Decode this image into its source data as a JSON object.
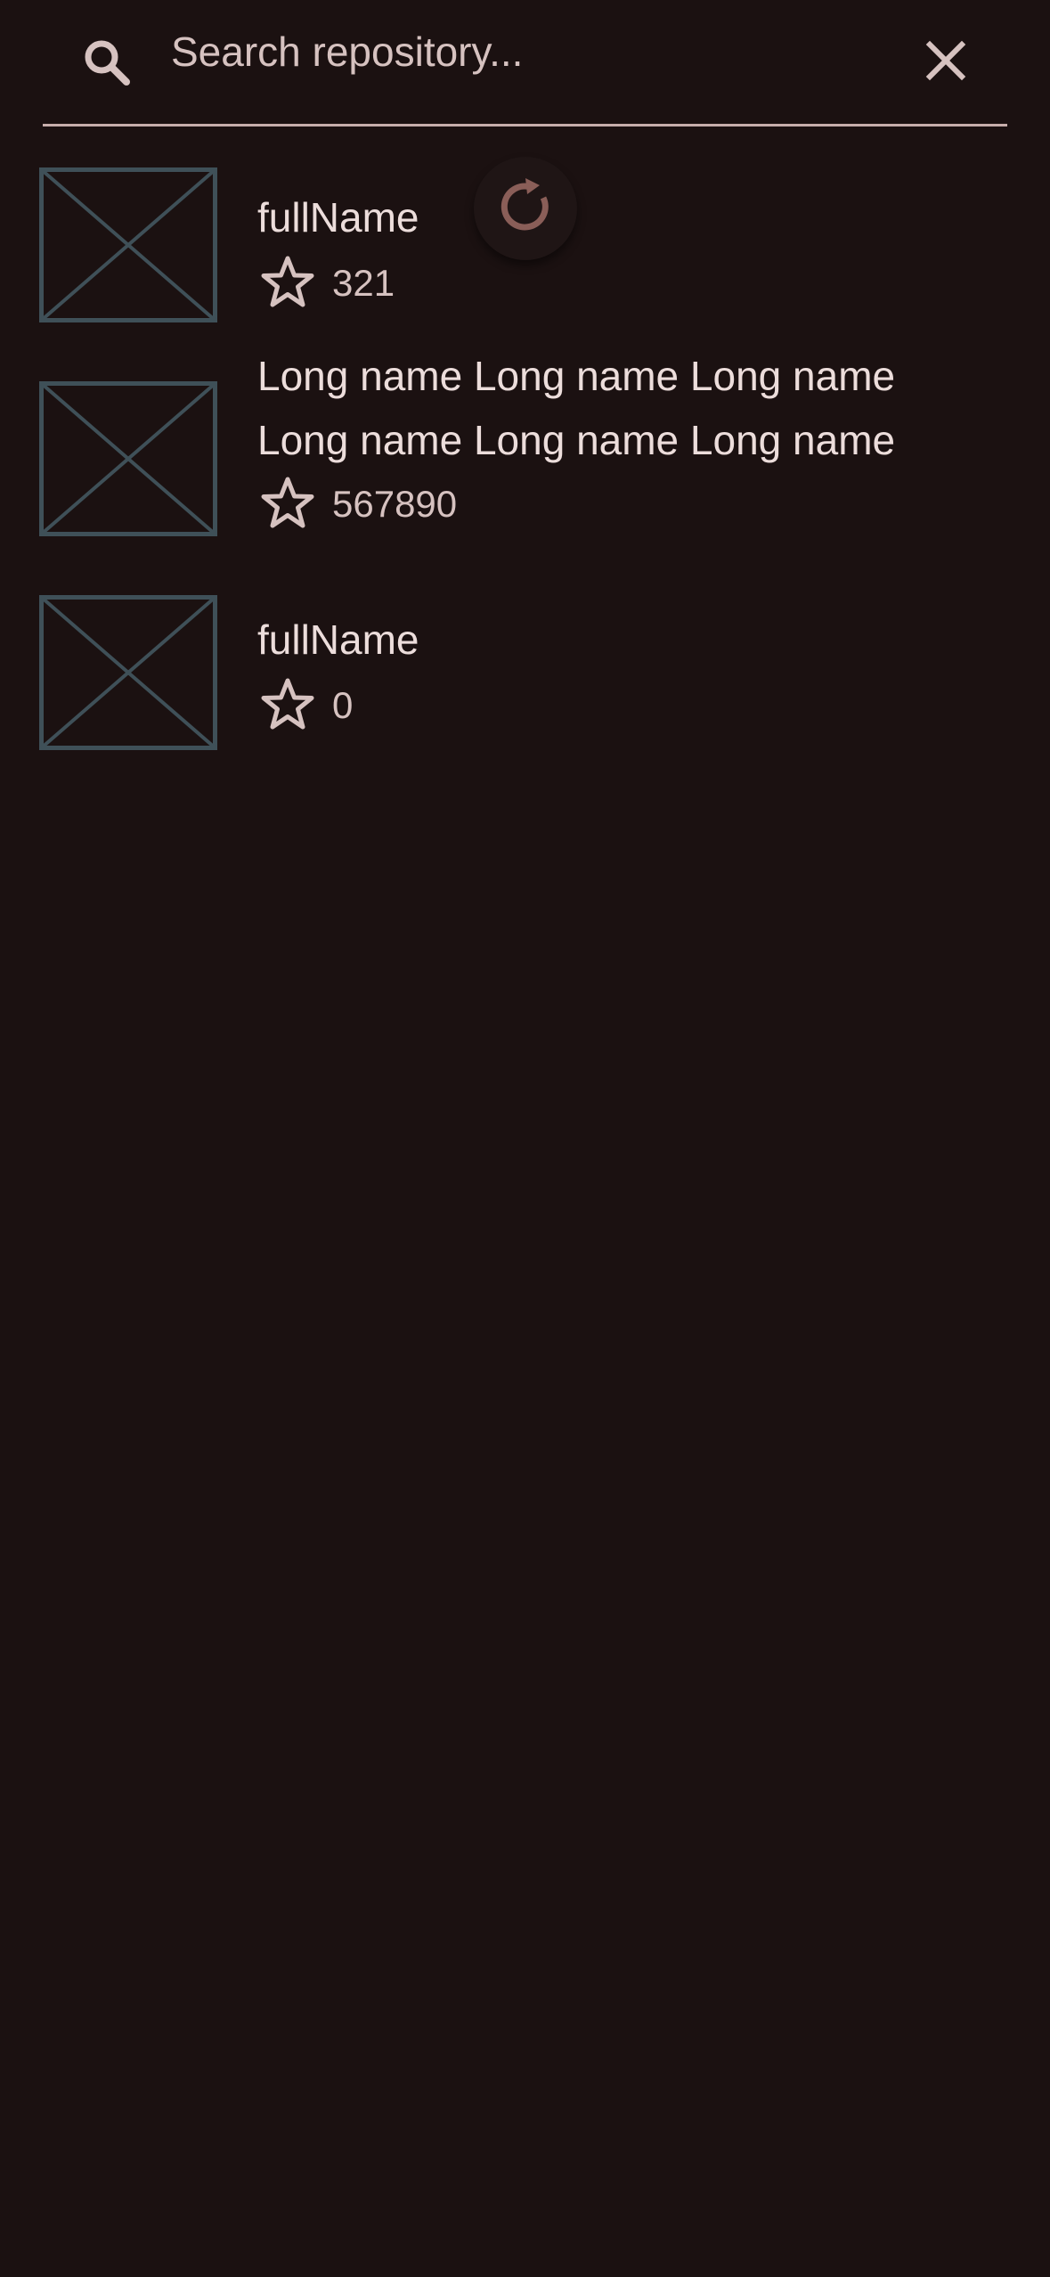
{
  "search": {
    "placeholder": "Search repository...",
    "value": ""
  },
  "icons": {
    "search": "search-icon",
    "clear": "close-icon",
    "star": "star-outline-icon",
    "thumbnail": "image-placeholder-icon",
    "loading": "refresh-spinner-icon"
  },
  "colors": {
    "background": "#1b1111",
    "text_primary": "#ecdddb",
    "text_secondary": "#d6c2c0",
    "divider": "#c7aeac",
    "placeholder_stroke": "#3f5058",
    "spinner": "#8a5e58"
  },
  "repositories": [
    {
      "name": "fullName",
      "stars": "321"
    },
    {
      "name": "Long name Long name Long name Long name Long name Long name",
      "stars": "567890"
    },
    {
      "name": "fullName",
      "stars": "0"
    }
  ],
  "loading": true
}
